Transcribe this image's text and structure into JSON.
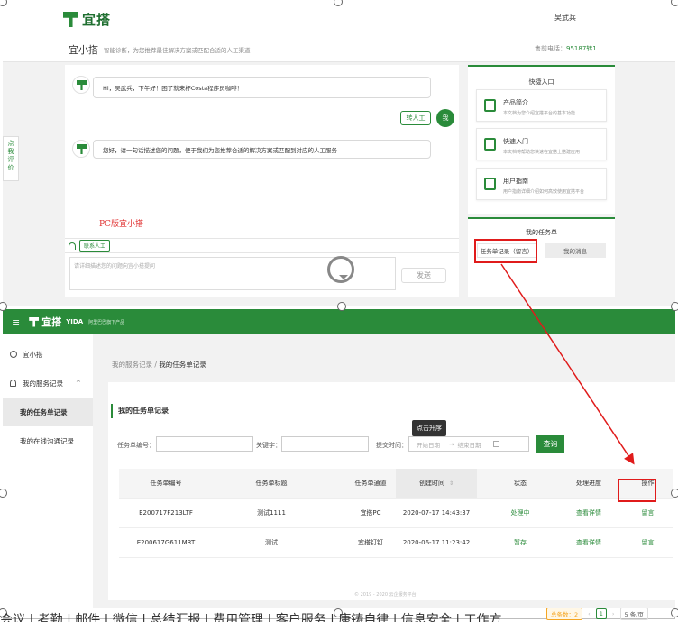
{
  "top_screen": {
    "logo_text": "宜搭",
    "user_name": "吴武兵",
    "assistant_title": "宜小搭",
    "assistant_desc": "智能诊断，为您推荐最佳解决方案或匹配合适的人工渠道",
    "hotline_label": "售前电话：",
    "hotline_number": "95187转1",
    "feedback_label": "点我评价",
    "messages": [
      {
        "text": "Hi，吴武兵，下午好！困了就来杯Costa程序员咖啡！"
      },
      {
        "text": "您好，请一句话描述您的问题，便于我们为您推荐合适的解决方案或匹配到对应的人工服务"
      }
    ],
    "transfer_button": "转人工",
    "me_avatar": "我",
    "annotation_pc": "PC版宜小搭",
    "contact_human": "联系人工",
    "input_placeholder": "请详细描述您的问题向宜小搭提问",
    "send_button": "发送",
    "quick_entry": {
      "title": "快捷入口",
      "items": [
        {
          "name": "产品简介",
          "desc": "本文档为您介绍宜搭平台的基本功能",
          "icon": "bulb-icon"
        },
        {
          "name": "快速入门",
          "desc": "本文档将帮助您快速在宜搭上搭建应用",
          "icon": "chart-icon"
        },
        {
          "name": "用户指南",
          "desc": "用户指南详细介绍如何高效使用宜搭平台",
          "icon": "document-icon"
        }
      ]
    },
    "my_tasks": {
      "title": "我的任务单",
      "record_button": "任务单记录（留言）",
      "message_button": "我的消息"
    }
  },
  "bottom_screen": {
    "logo_text": "宜搭",
    "logo_en": "YIDA",
    "slogan": "阿里巴巴旗下产品",
    "sidebar": [
      {
        "label": "宜小搭"
      },
      {
        "label": "我的服务记录"
      },
      {
        "label": "我的任务单记录"
      },
      {
        "label": "我的在线沟通记录"
      }
    ],
    "breadcrumb_parent": "我的服务记录",
    "breadcrumb_current": "我的任务单记录",
    "card_title": "我的任务单记录",
    "filters": {
      "task_no_label": "任务单编号：",
      "keyword_label": "关键字：",
      "submit_time_label": "提交时间：",
      "start_placeholder": "开始日期",
      "end_placeholder": "结束日期",
      "search_button": "查询"
    },
    "sort_tooltip": "点击升序",
    "table": {
      "headers": [
        "任务单编号",
        "任务单标题",
        "任务单通道",
        "创建时间",
        "状态",
        "处理进度",
        "操作"
      ],
      "rows": [
        [
          "E200717F213LTF",
          "测试1111",
          "宜搭PC",
          "2020-07-17 14:43:37",
          "处理中",
          "查看详情",
          "留言"
        ],
        [
          "E200617G611MRT",
          "测试",
          "宜搭钉钉",
          "2020-06-17 11:23:42",
          "暂存",
          "查看详情",
          "留言"
        ]
      ]
    },
    "pagination": {
      "total": "总条数：2",
      "current_page": "1",
      "page_size": "5 条/页"
    },
    "copyright": "© 2019 - 2020 云企服务平台"
  },
  "bottom_strip_text": "会议 | 考勤 | 邮件 | 微信 | 总结汇报 | 费用管理 | 客户服务 | 康铸自律 | 信息安全 | 工作方"
}
